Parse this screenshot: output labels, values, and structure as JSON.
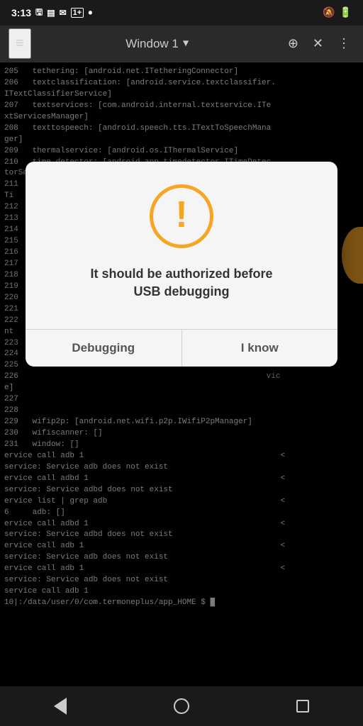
{
  "statusBar": {
    "time": "3:13",
    "leftIcons": [
      "sim-icon",
      "sd-card-icon",
      "notification-icon",
      "badge-icon",
      "dot-icon"
    ],
    "rightIcons": [
      "bell-mute-icon",
      "battery-icon"
    ]
  },
  "toolbar": {
    "menuLabel": "≡",
    "windowTitle": "Window 1",
    "dropdownIcon": "▼",
    "addIcon": "⊕",
    "closeIcon": "✕",
    "moreIcon": "⋮"
  },
  "terminal": {
    "lines": [
      "205   tethering: [android.net.ITetheringConnector]",
      "206   textclassification: [android.service.textclassifier.",
      "ITextClassifierService]",
      "207   textservices: [com.android.internal.textservice.ITe",
      "xtServicesManager]",
      "208   texttospeech: [android.speech.tts.ITextToSpeechMana",
      "ger]",
      "209   thermalservice: [android.os.IThermalService]",
      "210   time_detector: [android.app.timedetector.ITimeDetec",
      "torService]",
      "211   time_zone_detector: [android.app.timezonedetector.I",
      "Ti",
      "212",
      "213",
      "214",
      "215",
      "216",
      "217",
      "218",
      "219",
      "220",
      "221",
      "222                                                         e1",
      "nt",
      "223",
      "224",
      "225",
      "226                                                     vic",
      "e]",
      "227",
      "228",
      "229   wifip2p: [android.net.wifi.p2p.IWifiP2pManager]",
      "230   wifiscanner: []",
      "231   window: []",
      "ervice call adb 1                                          <",
      "service: Service adb does not exist",
      "ervice call adbd 1                                         <",
      "service: Service adbd does not exist",
      "ervice list | grep adb                                     <",
      "6     adb: []",
      "ervice call adbd 1                                         <",
      "service: Service adbd does not exist",
      "ervice call adb 1                                          <",
      "service: Service adb does not exist",
      "ervice call adb 1                                          <",
      "service: Service adb does not exist",
      "service call adb 1",
      "10|:/data/user/0/com.termoneplus/app_HOME $ █"
    ]
  },
  "modal": {
    "iconType": "exclamation",
    "message": "It should be authorized before\nUSB debugging",
    "buttons": [
      {
        "id": "debugging-btn",
        "label": "Debugging"
      },
      {
        "id": "i-know-btn",
        "label": "I know"
      }
    ]
  },
  "navBar": {
    "backLabel": "back",
    "homeLabel": "home",
    "recentLabel": "recent"
  },
  "colors": {
    "accent": "#f5a623",
    "terminalBg": "#000000",
    "terminalText": "#cccccc",
    "modalBg": "#f5f5f5",
    "buttonText": "#555555"
  }
}
